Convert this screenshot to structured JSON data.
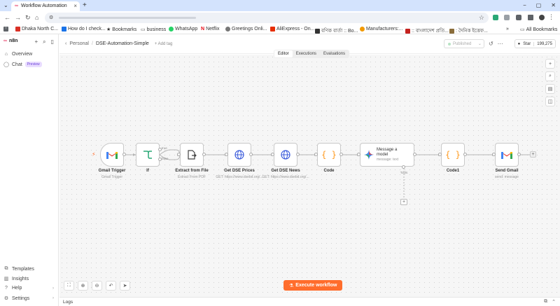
{
  "browser": {
    "tab_title": "Workflow Automation",
    "bookmarks": [
      {
        "label": "Dhaka North C..."
      },
      {
        "label": "How do I check..."
      },
      {
        "label": "Bookmarks"
      },
      {
        "label": "business"
      },
      {
        "label": "WhatsApp"
      },
      {
        "label": "Netflix"
      },
      {
        "label": "Greetings Onli..."
      },
      {
        "label": "AliExpress - On..."
      },
      {
        "label": "বণিক বার্তা :: Bo..."
      },
      {
        "label": "Manufacturers:..."
      },
      {
        "label": ":: বাংলাদেশ প্রতি..."
      },
      {
        "label": ": দৈনিক ইত্তেফ..."
      }
    ],
    "all_bookmarks": "All Bookmarks"
  },
  "app": {
    "logo_text": "n8n",
    "sidebar": {
      "overview": "Overview",
      "chat": "Chat",
      "chat_badge": "Preview",
      "templates": "Templates",
      "insights": "Insights",
      "help": "Help",
      "settings": "Settings"
    },
    "header": {
      "project": "Personal",
      "workflow_name": "DSE-Automation-Simple",
      "add_tag": "+ Add tag",
      "published": "Published",
      "star": "Star",
      "star_count": "199,275"
    },
    "tabs": [
      {
        "label": "Editor",
        "active": true
      },
      {
        "label": "Executions",
        "active": false
      },
      {
        "label": "Evaluations",
        "active": false
      }
    ],
    "nodes": [
      {
        "name": "Gmail Trigger",
        "sub": "Gmail Trigger"
      },
      {
        "name": "If",
        "sub": ""
      },
      {
        "name": "Extract from File",
        "sub": "Extract From PDF"
      },
      {
        "name": "Get DSE Prices",
        "sub": "GET: https://www.dsebd.org/..."
      },
      {
        "name": "Get DSE News",
        "sub": "GET: https://www.dsebd.org/..."
      },
      {
        "name": "Code",
        "sub": ""
      },
      {
        "name": "Message a model",
        "sub": "message: text"
      },
      {
        "name": "Code1",
        "sub": ""
      },
      {
        "name": "Send Gmail",
        "sub": "send: message"
      }
    ],
    "if_outputs": {
      "true": "true",
      "false": "false"
    },
    "ai_tools_label": "Tools",
    "execute_button": "Execute workflow",
    "logs_label": "Logs"
  }
}
